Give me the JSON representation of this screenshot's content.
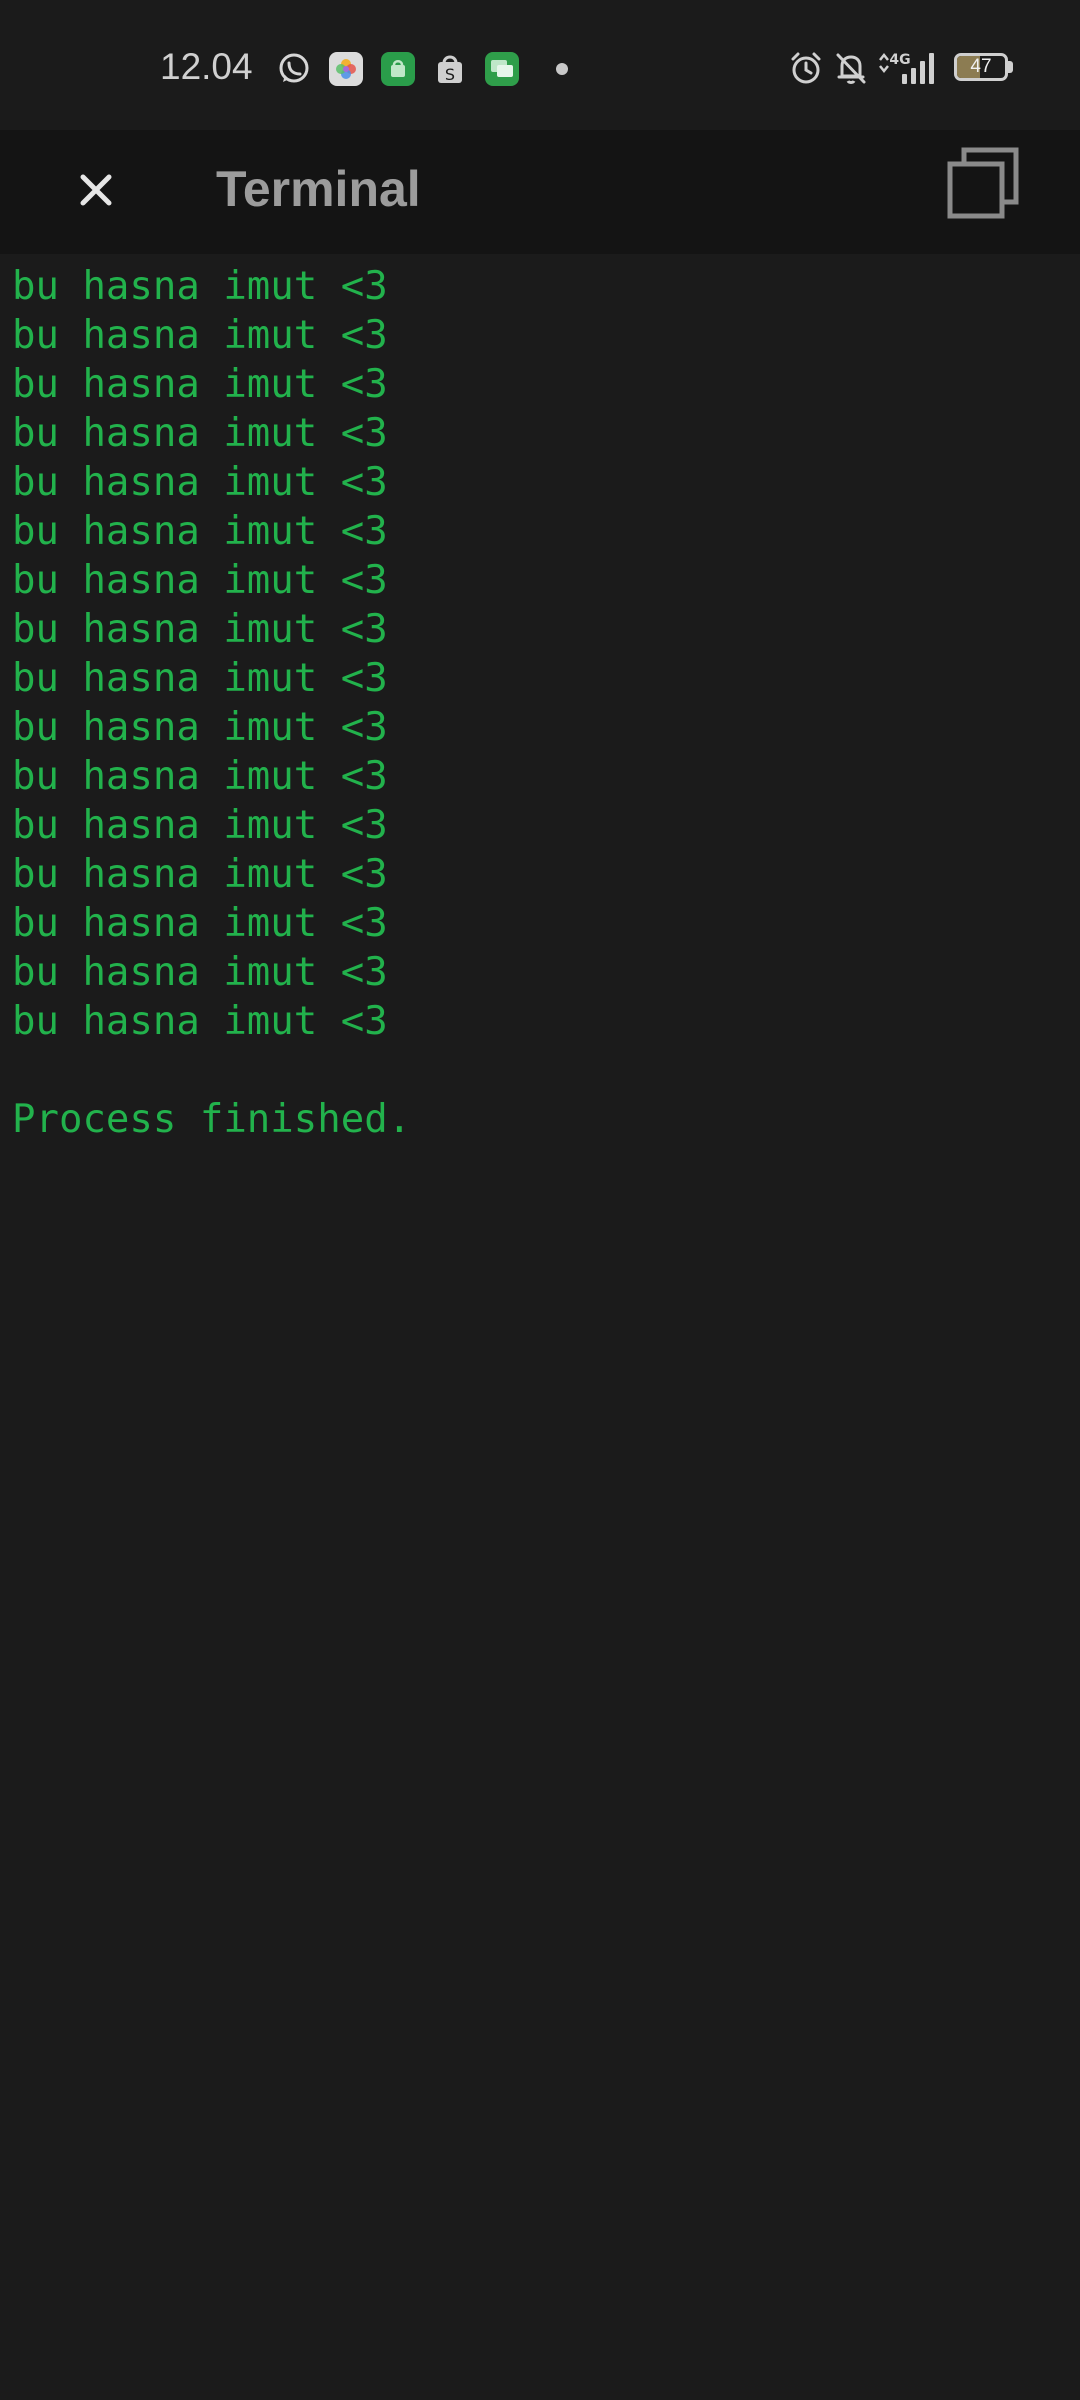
{
  "status_bar": {
    "time": "12.04",
    "notification_icons": [
      "whatsapp-icon",
      "photos-icon",
      "android-store-icon",
      "shopping-bag-icon",
      "chat-icon"
    ],
    "system_icons": [
      "alarm-icon",
      "bell-off-icon",
      "mobile-data-4g-icon",
      "signal-icon"
    ],
    "network_label": "4G",
    "battery_level": "47"
  },
  "app_bar": {
    "title": "Terminal",
    "close_icon": "close-icon",
    "copy_icon": "copy-icon"
  },
  "terminal": {
    "lines": [
      "bu hasna imut <3",
      "bu hasna imut <3",
      "bu hasna imut <3",
      "bu hasna imut <3",
      "bu hasna imut <3",
      "bu hasna imut <3",
      "bu hasna imut <3",
      "bu hasna imut <3",
      "bu hasna imut <3",
      "bu hasna imut <3",
      "bu hasna imut <3",
      "bu hasna imut <3",
      "bu hasna imut <3",
      "bu hasna imut <3",
      "bu hasna imut <3",
      "bu hasna imut <3"
    ],
    "status": "Process finished."
  },
  "colors": {
    "background": "#1b1b1b",
    "app_bar_bg": "#141414",
    "terminal_text": "#22b24c",
    "title_text": "#9c9c9c",
    "battery_fill": "#8c7c52"
  }
}
